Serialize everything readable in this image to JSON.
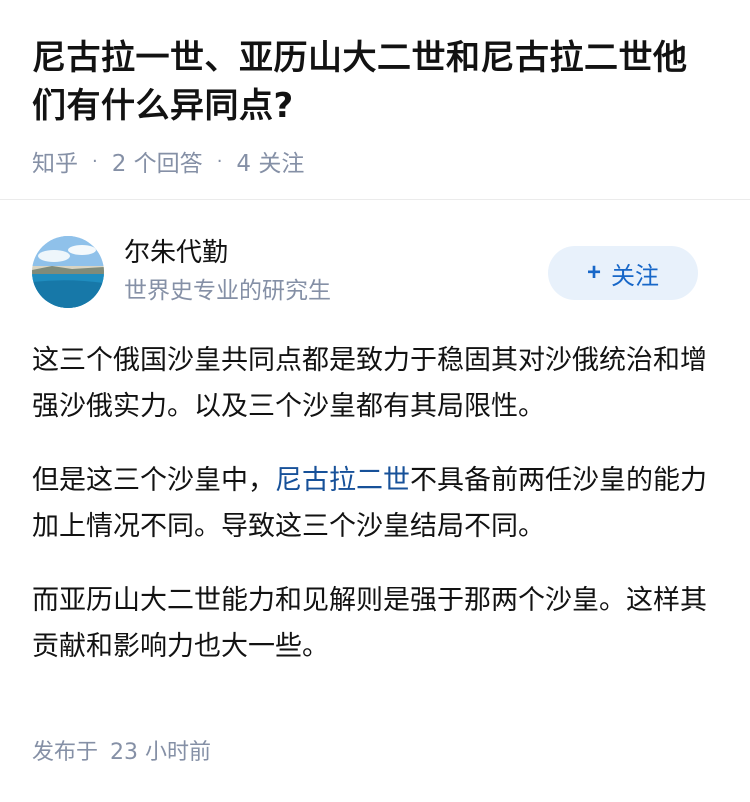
{
  "question": {
    "title": "尼古拉一世、亚历山大二世和尼古拉二世他们有什么异同点?",
    "source": "知乎",
    "separator": "·",
    "answers": "2 个回答",
    "followers": "4 关注"
  },
  "author": {
    "name": "尔朱代勤",
    "bio": "世界史专业的研究生",
    "avatar_icon": "avatar-landscape-sea",
    "follow_plus": "+",
    "follow_label": "关注"
  },
  "answer": {
    "p1": "这三个俄国沙皇共同点都是致力于稳固其对沙俄统治和增强沙俄实力。以及三个沙皇都有其局限性。",
    "p2_before": "但是这三个沙皇中，",
    "p2_link": "尼古拉二世",
    "p2_after": "不具备前两任沙皇的能力加上情况不同。导致这三个沙皇结局不同。",
    "p3": "而亚历山大二世能力和见解则是强于那两个沙皇。这样其贡献和影响力也大一些。"
  },
  "footer": {
    "published_label": "发布于",
    "published_time": "23 小时前"
  },
  "colors": {
    "meta_gray": "#8590a6",
    "link_blue": "#175199",
    "follow_blue": "#1767c8",
    "follow_bg": "#e8f1fb"
  }
}
